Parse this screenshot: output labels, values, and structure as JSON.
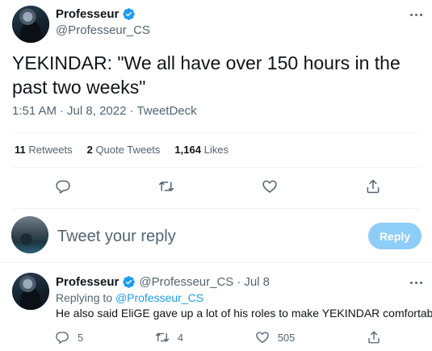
{
  "main_tweet": {
    "author_name": "Professeur",
    "author_handle": "@Professeur_CS",
    "text": "YEKINDAR: \"We all have over 150 hours in the past two weeks\"",
    "time": "1:51 AM",
    "separator1": "·",
    "date": "Jul 8, 2022",
    "separator2": "·",
    "source": "TweetDeck",
    "stats": {
      "retweets_count": "11",
      "retweets_label": "Retweets",
      "quotes_count": "2",
      "quotes_label": "Quote Tweets",
      "likes_count": "1,164",
      "likes_label": "Likes"
    }
  },
  "composer": {
    "placeholder": "Tweet your reply",
    "button_label": "Reply"
  },
  "reply_tweet": {
    "author_name": "Professeur",
    "author_handle": "@Professeur_CS",
    "separator": "·",
    "date": "Jul 8",
    "replying_to_label": "Replying to",
    "replying_to_handle": "@Professeur_CS",
    "text": "He also said EliGE gave up a lot of his roles to make YEKINDAR comfortable",
    "reply_count": "5",
    "retweet_count": "4",
    "like_count": "505"
  },
  "colors": {
    "accent": "#1d9bf0",
    "muted": "#536471",
    "reply_button_disabled": "#8ecdf8"
  },
  "icons": [
    "verified-badge-icon",
    "more-icon",
    "reply-icon",
    "retweet-icon",
    "like-icon",
    "share-icon"
  ]
}
